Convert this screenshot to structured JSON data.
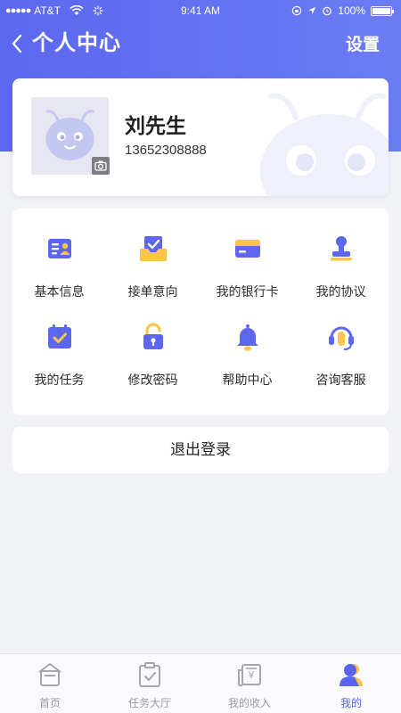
{
  "status_bar": {
    "signal_dots": "●●●●●",
    "carrier": "AT&T",
    "time": "9:41 AM",
    "battery": "100%"
  },
  "navbar": {
    "back_icon": "chevron-left-icon",
    "title": "个人中心",
    "action": "设置"
  },
  "profile": {
    "name": "刘先生",
    "phone": "13652308888"
  },
  "menu": {
    "items": [
      {
        "label": "基本信息",
        "icon": "id-card-icon"
      },
      {
        "label": "接单意向",
        "icon": "inbox-check-icon"
      },
      {
        "label": "我的银行卡",
        "icon": "bank-card-icon"
      },
      {
        "label": "我的协议",
        "icon": "stamp-icon"
      },
      {
        "label": "我的任务",
        "icon": "calendar-check-icon"
      },
      {
        "label": "修改密码",
        "icon": "lock-icon"
      },
      {
        "label": "帮助中心",
        "icon": "bell-icon"
      },
      {
        "label": "咨询客服",
        "icon": "headset-icon"
      }
    ]
  },
  "logout_label": "退出登录",
  "tabbar": {
    "active_index": 3,
    "tabs": [
      {
        "label": "首页",
        "icon": "home-icon"
      },
      {
        "label": "任务大厅",
        "icon": "task-icon"
      },
      {
        "label": "我的收入",
        "icon": "income-icon"
      },
      {
        "label": "我的",
        "icon": "user-icon"
      }
    ]
  },
  "colors": {
    "primary": "#5c67ee",
    "accent_yellow": "#fcc44a",
    "background": "#f1f2f6"
  }
}
